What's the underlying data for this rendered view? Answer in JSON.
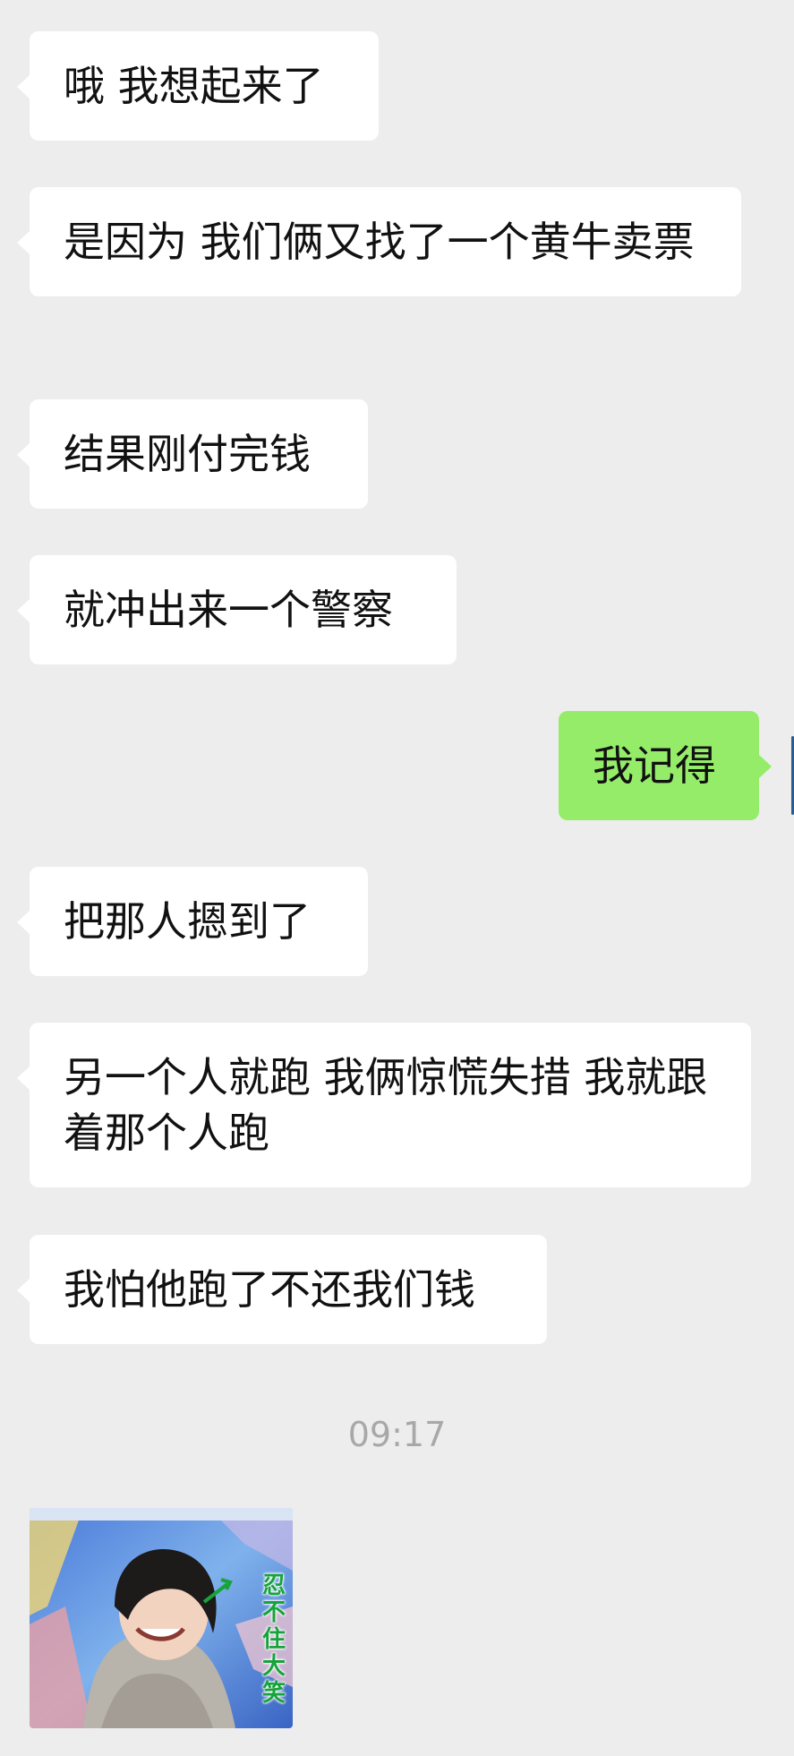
{
  "messages": [
    {
      "side": "recv",
      "text": "哦 我想起来了"
    },
    {
      "side": "recv",
      "text": "是因为 我们俩又找了一个黄牛卖票"
    },
    {
      "side": "recv",
      "text": "结果刚付完钱"
    },
    {
      "side": "recv",
      "text": "就冲出来一个警察"
    },
    {
      "side": "sent",
      "text": "我记得"
    },
    {
      "side": "recv",
      "text": "把那人摁到了"
    },
    {
      "side": "recv",
      "text": "另一个人就跑 我俩惊慌失措 我就跟着那个人跑"
    },
    {
      "side": "recv",
      "text": "我怕他跑了不还我们钱"
    }
  ],
  "timestamp": "09:17",
  "sticker": {
    "caption": "忍不住大笑"
  },
  "colors": {
    "background": "#ededed",
    "received_bubble": "#ffffff",
    "sent_bubble": "#95ec69",
    "timestamp_text": "#a8a8a8",
    "sticker_caption": "#16a43a"
  }
}
